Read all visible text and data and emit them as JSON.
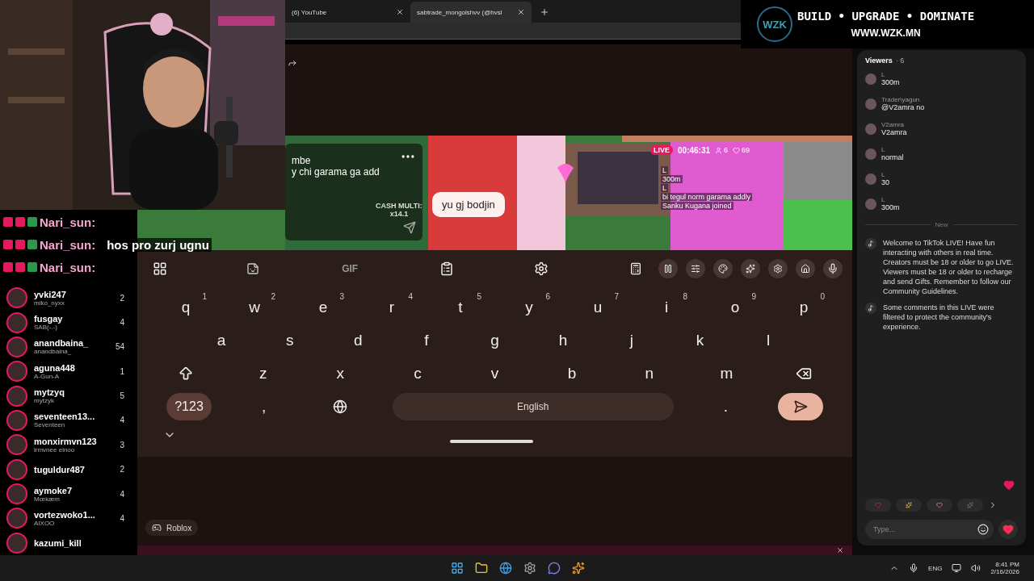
{
  "browser": {
    "tabs": [
      {
        "title": "(6) YouTube",
        "selected": false
      },
      {
        "title": "sabtrade_mongolshvv (@hvsl",
        "selected": true
      }
    ]
  },
  "banner": {
    "logo": "WZK",
    "slogan": "BUILD • UPGRADE • DOMINATE",
    "url": "WWW.WZK.MN"
  },
  "stream_chat": [
    {
      "user": "Nari_sun:"
    },
    {
      "user": "Nari_sun:",
      "message": "hos pro zurj ugnu"
    },
    {
      "user": "Nari_sun:"
    }
  ],
  "creators": [
    {
      "name": "yvki247",
      "subtitle": "miko_nyxx",
      "count": "2"
    },
    {
      "name": "fusgay",
      "subtitle": "SAB(-.-)",
      "count": "4"
    },
    {
      "name": "anandbaina_",
      "subtitle": "anandbaina_",
      "count": "54"
    },
    {
      "name": "aguna448",
      "subtitle": "A-Gun-A",
      "count": "1"
    },
    {
      "name": "mytzyq",
      "subtitle": "mytzyk",
      "count": "5"
    },
    {
      "name": "seventeen13...",
      "subtitle": "Seventeen",
      "count": "4"
    },
    {
      "name": "monxirmvn123",
      "subtitle": "lrmvnee elnoo",
      "count": "3"
    },
    {
      "name": "tuguldur487",
      "count": "2"
    },
    {
      "name": "aymoke7",
      "subtitle": "Mœkæm",
      "count": "4"
    },
    {
      "name": "vortezwoko1...",
      "subtitle": "AIXOO",
      "count": "4"
    },
    {
      "name": "kazumi_kill"
    }
  ],
  "video": {
    "left_chat": [
      "mbe",
      "y chi garama ga add"
    ],
    "cash_label": "CASH MULTI:",
    "cash_value": "x14.1",
    "bubble": "yu gj bodjin",
    "live": {
      "badge": "LIVE",
      "time": "00:46:31",
      "viewers": "6",
      "likes": "69"
    },
    "comments": [
      "L",
      "300m",
      "L",
      "bi tegul norm garama addly",
      "Sanku Kugana joined"
    ]
  },
  "keyboard": {
    "gif": "GIF",
    "rows": [
      [
        {
          "kind": "letter",
          "label": "q",
          "hint": "1"
        },
        {
          "kind": "letter",
          "label": "w",
          "hint": "2"
        },
        {
          "kind": "letter",
          "label": "e",
          "hint": "3"
        },
        {
          "kind": "letter",
          "label": "r",
          "hint": "4"
        },
        {
          "kind": "letter",
          "label": "t",
          "hint": "5"
        },
        {
          "kind": "letter",
          "label": "y",
          "hint": "6"
        },
        {
          "kind": "letter",
          "label": "u",
          "hint": "7"
        },
        {
          "kind": "letter",
          "label": "i",
          "hint": "8"
        },
        {
          "kind": "letter",
          "label": "o",
          "hint": "9"
        },
        {
          "kind": "letter",
          "label": "p",
          "hint": "0"
        }
      ],
      [
        {
          "kind": "letter",
          "label": "a"
        },
        {
          "kind": "letter",
          "label": "s"
        },
        {
          "kind": "letter",
          "label": "d"
        },
        {
          "kind": "letter",
          "label": "f"
        },
        {
          "kind": "letter",
          "label": "g"
        },
        {
          "kind": "letter",
          "label": "h"
        },
        {
          "kind": "letter",
          "label": "j"
        },
        {
          "kind": "letter",
          "label": "k"
        },
        {
          "kind": "letter",
          "label": "l"
        }
      ],
      [
        {
          "kind": "shift"
        },
        {
          "kind": "letter",
          "label": "z"
        },
        {
          "kind": "letter",
          "label": "x"
        },
        {
          "kind": "letter",
          "label": "c"
        },
        {
          "kind": "letter",
          "label": "v"
        },
        {
          "kind": "letter",
          "label": "b"
        },
        {
          "kind": "letter",
          "label": "n"
        },
        {
          "kind": "letter",
          "label": "m"
        },
        {
          "kind": "backspace"
        }
      ],
      [
        {
          "kind": "mode",
          "label": "?123"
        },
        {
          "kind": "letter",
          "label": ","
        },
        {
          "kind": "globe"
        },
        {
          "kind": "space",
          "label": "English"
        },
        {
          "kind": "letter",
          "label": "."
        },
        {
          "kind": "enter"
        }
      ]
    ],
    "category": "Roblox"
  },
  "viewers_panel": {
    "title": "Viewers",
    "count": "· 6",
    "comments": [
      {
        "user": "L",
        "text": "300m"
      },
      {
        "user": "Trader\\yagun",
        "text": "@V2amra no"
      },
      {
        "user": "V2amra",
        "text": "V2amra"
      },
      {
        "user": "L",
        "text": "normal"
      },
      {
        "user": "L",
        "text": "30"
      },
      {
        "user": "L",
        "text": "300m"
      }
    ],
    "divider": "New",
    "system": [
      "Welcome to TikTok LIVE! Have fun interacting with others in real time. Creators must be 18 or older to go LIVE. Viewers must be 18 or older to recharge and send Gifts. Remember to follow our Community Guidelines.",
      "Some comments in this LIVE were filtered to protect the community's experience."
    ],
    "placeholder": "Type..."
  },
  "taskbar": {
    "language": "ENG",
    "time": "8:41 PM",
    "date": "2/16/2026"
  }
}
